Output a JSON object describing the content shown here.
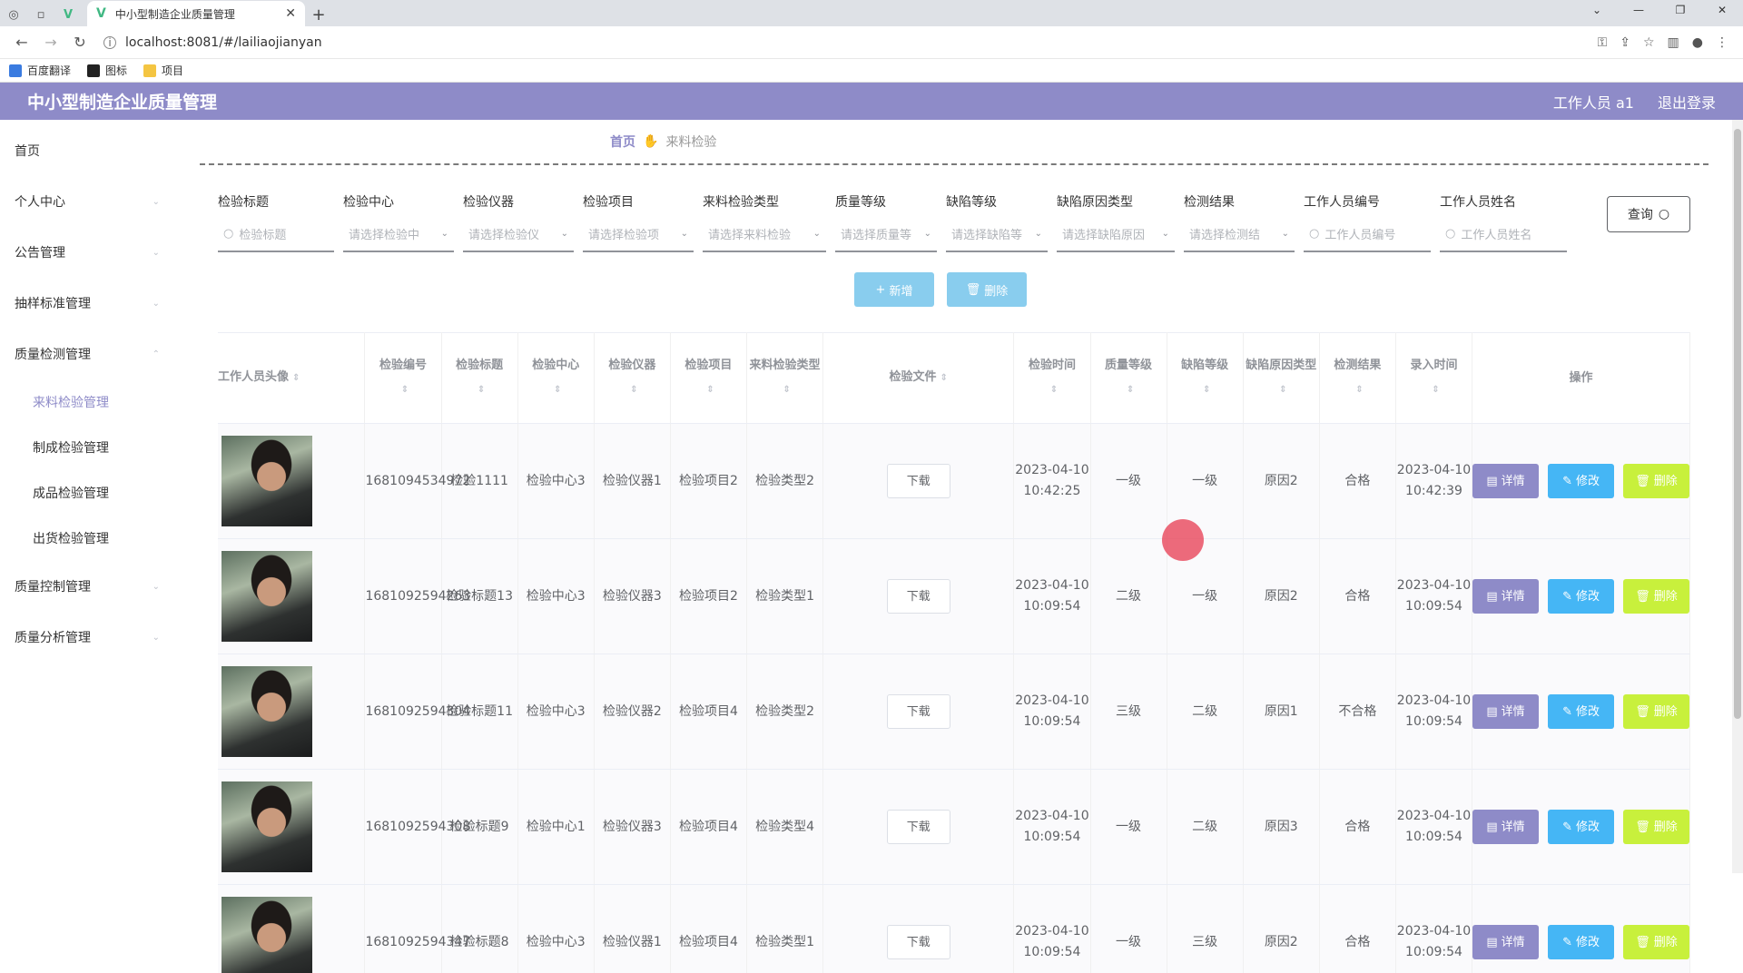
{
  "browser": {
    "tab_title": "中小型制造企业质量管理",
    "url": "localhost:8081/#/lailiaojianyan",
    "bookmarks": [
      "百度翻译",
      "图标",
      "项目"
    ]
  },
  "header": {
    "title": "中小型制造企业质量管理",
    "user": "工作人员 a1",
    "logout": "退出登录"
  },
  "sidebar": {
    "items": [
      {
        "label": "首页"
      },
      {
        "label": "个人中心"
      },
      {
        "label": "公告管理"
      },
      {
        "label": "抽样标准管理"
      },
      {
        "label": "质量检测管理"
      }
    ],
    "sub_items": [
      {
        "label": "来料检验管理",
        "active": true
      },
      {
        "label": "制成检验管理"
      },
      {
        "label": "成品检验管理"
      },
      {
        "label": "出货检验管理"
      }
    ],
    "items_after": [
      {
        "label": "质量控制管理"
      },
      {
        "label": "质量分析管理"
      }
    ]
  },
  "breadcrumb": {
    "home": "首页",
    "current": "来料检验"
  },
  "filters": [
    {
      "label": "检验标题",
      "placeholder": "检验标题",
      "type": "input"
    },
    {
      "label": "检验中心",
      "placeholder": "请选择检验中",
      "type": "select"
    },
    {
      "label": "检验仪器",
      "placeholder": "请选择检验仪",
      "type": "select"
    },
    {
      "label": "检验项目",
      "placeholder": "请选择检验项",
      "type": "select"
    },
    {
      "label": "来料检验类型",
      "placeholder": "请选择来料检验",
      "type": "select"
    },
    {
      "label": "质量等级",
      "placeholder": "请选择质量等",
      "type": "select"
    },
    {
      "label": "缺陷等级",
      "placeholder": "请选择缺陷等",
      "type": "select"
    },
    {
      "label": "缺陷原因类型",
      "placeholder": "请选择缺陷原因",
      "type": "select"
    },
    {
      "label": "检测结果",
      "placeholder": "请选择检测结",
      "type": "select"
    },
    {
      "label": "工作人员编号",
      "placeholder": "工作人员编号",
      "type": "input"
    },
    {
      "label": "工作人员姓名",
      "placeholder": "工作人员姓名",
      "type": "input"
    }
  ],
  "query_label": "查询",
  "add_label": "新增",
  "delete_label": "删除",
  "table": {
    "headers": [
      "工作人员头像",
      "检验编号",
      "检验标题",
      "检验中心",
      "检验仪器",
      "检验项目",
      "来料检验类型",
      "检验文件",
      "检验时间",
      "质量等级",
      "缺陷等级",
      "缺陷原因类型",
      "检测结果",
      "录入时间",
      "操作"
    ],
    "download_label": "下载",
    "detail_label": "详情",
    "edit_label": "修改",
    "remove_label": "删除",
    "rows": [
      {
        "id": "1681094534972",
        "title": "检验1111",
        "center": "检验中心3",
        "instrument": "检验仪器1",
        "item": "检验项目2",
        "type": "检验类型2",
        "time": "2023-04-10 10:42:25",
        "quality": "一级",
        "defect": "一级",
        "reason": "原因2",
        "result": "合格",
        "entry": "2023-04-10 10:42:39"
      },
      {
        "id": "1681092594263",
        "title": "检验标题13",
        "center": "检验中心3",
        "instrument": "检验仪器3",
        "item": "检验项目2",
        "type": "检验类型1",
        "time": "2023-04-10 10:09:54",
        "quality": "二级",
        "defect": "一级",
        "reason": "原因2",
        "result": "合格",
        "entry": "2023-04-10 10:09:54"
      },
      {
        "id": "1681092594304",
        "title": "检验标题11",
        "center": "检验中心3",
        "instrument": "检验仪器2",
        "item": "检验项目4",
        "type": "检验类型2",
        "time": "2023-04-10 10:09:54",
        "quality": "三级",
        "defect": "二级",
        "reason": "原因1",
        "result": "不合格",
        "entry": "2023-04-10 10:09:54"
      },
      {
        "id": "1681092594308",
        "title": "检验标题9",
        "center": "检验中心1",
        "instrument": "检验仪器3",
        "item": "检验项目4",
        "type": "检验类型4",
        "time": "2023-04-10 10:09:54",
        "quality": "一级",
        "defect": "二级",
        "reason": "原因3",
        "result": "合格",
        "entry": "2023-04-10 10:09:54"
      },
      {
        "id": "1681092594347",
        "title": "检验标题8",
        "center": "检验中心3",
        "instrument": "检验仪器1",
        "item": "检验项目4",
        "type": "检验类型1",
        "time": "2023-04-10 10:09:54",
        "quality": "一级",
        "defect": "三级",
        "reason": "原因2",
        "result": "合格",
        "entry": "2023-04-10 10:09:54"
      }
    ]
  }
}
